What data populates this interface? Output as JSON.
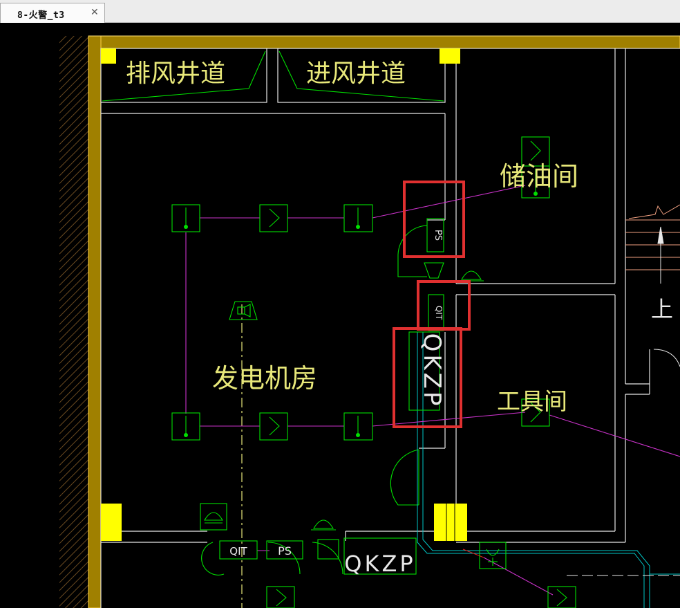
{
  "tab": {
    "title": "8-火警_t3",
    "close": "✕"
  },
  "rooms": {
    "exhaust_shaft": "排风井道",
    "intake_shaft": "进风井道",
    "oil_storage": "储油间",
    "generator_room": "发电机房",
    "tool_room": "工具间",
    "stairs_up": "上"
  },
  "devices": {
    "ps": "PS",
    "qit": "QIT",
    "qkzp": "QKZP",
    "qit_bottom": "QIT",
    "ps_bottom": "PS",
    "qkzp_bottom": "QKZP"
  },
  "colors": {
    "background": "#000000",
    "wall": "#a08000",
    "column": "#ffff00",
    "device": "#00ff00",
    "wiring": "#cc33cc",
    "text": "#e8e87a",
    "highlight": "#e03030"
  }
}
